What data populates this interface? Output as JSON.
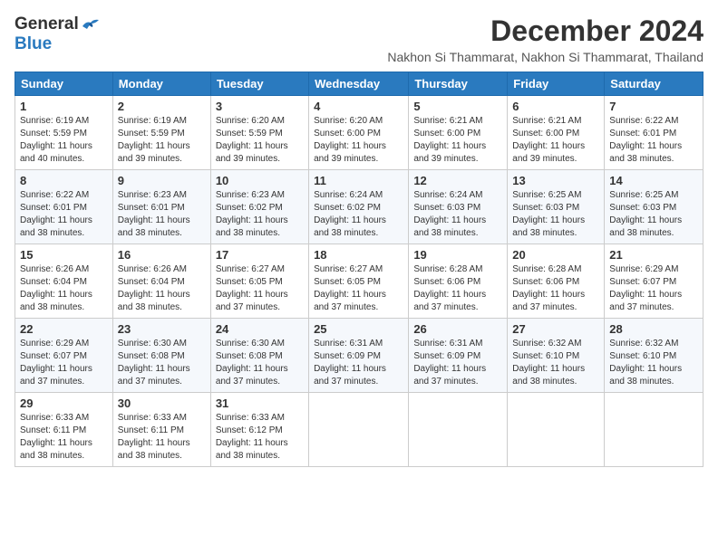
{
  "header": {
    "logo_general": "General",
    "logo_blue": "Blue",
    "month_title": "December 2024",
    "subtitle": "Nakhon Si Thammarat, Nakhon Si Thammarat, Thailand"
  },
  "days_of_week": [
    "Sunday",
    "Monday",
    "Tuesday",
    "Wednesday",
    "Thursday",
    "Friday",
    "Saturday"
  ],
  "weeks": [
    [
      {
        "day": "1",
        "sunrise": "6:19 AM",
        "sunset": "5:59 PM",
        "daylight": "11 hours and 40 minutes."
      },
      {
        "day": "2",
        "sunrise": "6:19 AM",
        "sunset": "5:59 PM",
        "daylight": "11 hours and 39 minutes."
      },
      {
        "day": "3",
        "sunrise": "6:20 AM",
        "sunset": "5:59 PM",
        "daylight": "11 hours and 39 minutes."
      },
      {
        "day": "4",
        "sunrise": "6:20 AM",
        "sunset": "6:00 PM",
        "daylight": "11 hours and 39 minutes."
      },
      {
        "day": "5",
        "sunrise": "6:21 AM",
        "sunset": "6:00 PM",
        "daylight": "11 hours and 39 minutes."
      },
      {
        "day": "6",
        "sunrise": "6:21 AM",
        "sunset": "6:00 PM",
        "daylight": "11 hours and 39 minutes."
      },
      {
        "day": "7",
        "sunrise": "6:22 AM",
        "sunset": "6:01 PM",
        "daylight": "11 hours and 38 minutes."
      }
    ],
    [
      {
        "day": "8",
        "sunrise": "6:22 AM",
        "sunset": "6:01 PM",
        "daylight": "11 hours and 38 minutes."
      },
      {
        "day": "9",
        "sunrise": "6:23 AM",
        "sunset": "6:01 PM",
        "daylight": "11 hours and 38 minutes."
      },
      {
        "day": "10",
        "sunrise": "6:23 AM",
        "sunset": "6:02 PM",
        "daylight": "11 hours and 38 minutes."
      },
      {
        "day": "11",
        "sunrise": "6:24 AM",
        "sunset": "6:02 PM",
        "daylight": "11 hours and 38 minutes."
      },
      {
        "day": "12",
        "sunrise": "6:24 AM",
        "sunset": "6:03 PM",
        "daylight": "11 hours and 38 minutes."
      },
      {
        "day": "13",
        "sunrise": "6:25 AM",
        "sunset": "6:03 PM",
        "daylight": "11 hours and 38 minutes."
      },
      {
        "day": "14",
        "sunrise": "6:25 AM",
        "sunset": "6:03 PM",
        "daylight": "11 hours and 38 minutes."
      }
    ],
    [
      {
        "day": "15",
        "sunrise": "6:26 AM",
        "sunset": "6:04 PM",
        "daylight": "11 hours and 38 minutes."
      },
      {
        "day": "16",
        "sunrise": "6:26 AM",
        "sunset": "6:04 PM",
        "daylight": "11 hours and 38 minutes."
      },
      {
        "day": "17",
        "sunrise": "6:27 AM",
        "sunset": "6:05 PM",
        "daylight": "11 hours and 37 minutes."
      },
      {
        "day": "18",
        "sunrise": "6:27 AM",
        "sunset": "6:05 PM",
        "daylight": "11 hours and 37 minutes."
      },
      {
        "day": "19",
        "sunrise": "6:28 AM",
        "sunset": "6:06 PM",
        "daylight": "11 hours and 37 minutes."
      },
      {
        "day": "20",
        "sunrise": "6:28 AM",
        "sunset": "6:06 PM",
        "daylight": "11 hours and 37 minutes."
      },
      {
        "day": "21",
        "sunrise": "6:29 AM",
        "sunset": "6:07 PM",
        "daylight": "11 hours and 37 minutes."
      }
    ],
    [
      {
        "day": "22",
        "sunrise": "6:29 AM",
        "sunset": "6:07 PM",
        "daylight": "11 hours and 37 minutes."
      },
      {
        "day": "23",
        "sunrise": "6:30 AM",
        "sunset": "6:08 PM",
        "daylight": "11 hours and 37 minutes."
      },
      {
        "day": "24",
        "sunrise": "6:30 AM",
        "sunset": "6:08 PM",
        "daylight": "11 hours and 37 minutes."
      },
      {
        "day": "25",
        "sunrise": "6:31 AM",
        "sunset": "6:09 PM",
        "daylight": "11 hours and 37 minutes."
      },
      {
        "day": "26",
        "sunrise": "6:31 AM",
        "sunset": "6:09 PM",
        "daylight": "11 hours and 37 minutes."
      },
      {
        "day": "27",
        "sunrise": "6:32 AM",
        "sunset": "6:10 PM",
        "daylight": "11 hours and 38 minutes."
      },
      {
        "day": "28",
        "sunrise": "6:32 AM",
        "sunset": "6:10 PM",
        "daylight": "11 hours and 38 minutes."
      }
    ],
    [
      {
        "day": "29",
        "sunrise": "6:33 AM",
        "sunset": "6:11 PM",
        "daylight": "11 hours and 38 minutes."
      },
      {
        "day": "30",
        "sunrise": "6:33 AM",
        "sunset": "6:11 PM",
        "daylight": "11 hours and 38 minutes."
      },
      {
        "day": "31",
        "sunrise": "6:33 AM",
        "sunset": "6:12 PM",
        "daylight": "11 hours and 38 minutes."
      },
      null,
      null,
      null,
      null
    ]
  ],
  "labels": {
    "sunrise": "Sunrise:",
    "sunset": "Sunset:",
    "daylight": "Daylight:"
  }
}
